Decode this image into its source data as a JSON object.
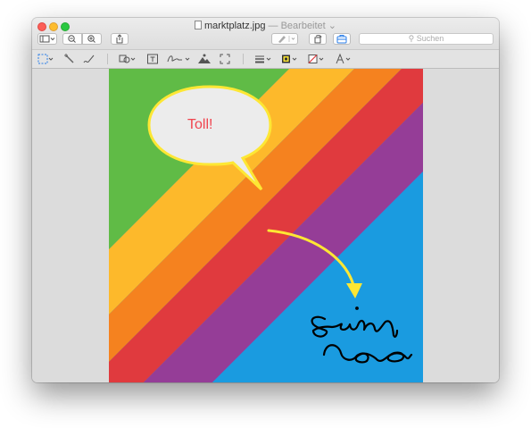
{
  "window": {
    "title": "marktplatz.jpg",
    "edited_status": "— Bearbeitet",
    "search_placeholder": "Suchen"
  },
  "toolbar": {
    "icons": [
      "sidebar-icon",
      "zoom-out-icon",
      "zoom-in-icon",
      "share-icon",
      "pen-icon",
      "rotate-icon",
      "markup-toolbox-icon"
    ]
  },
  "markup_toolbar": {
    "tools": [
      "rectangular-selection-icon",
      "instant-alpha-icon",
      "sketch-icon",
      "shapes-icon",
      "text-icon",
      "sign-icon",
      "adjust-color-icon",
      "adjust-size-icon",
      "shape-style-icon",
      "border-color-icon",
      "fill-color-icon",
      "text-style-icon"
    ]
  },
  "image": {
    "speech_bubble_text": "Toll!",
    "stripe_colors": [
      "#60bb46",
      "#fdb92b",
      "#f5821f",
      "#e03a3e",
      "#953d97",
      "#1a9be0"
    ],
    "bubble_fill": "#ececec",
    "annotation_color": "#fde734",
    "handwriting_color": "#000000"
  }
}
